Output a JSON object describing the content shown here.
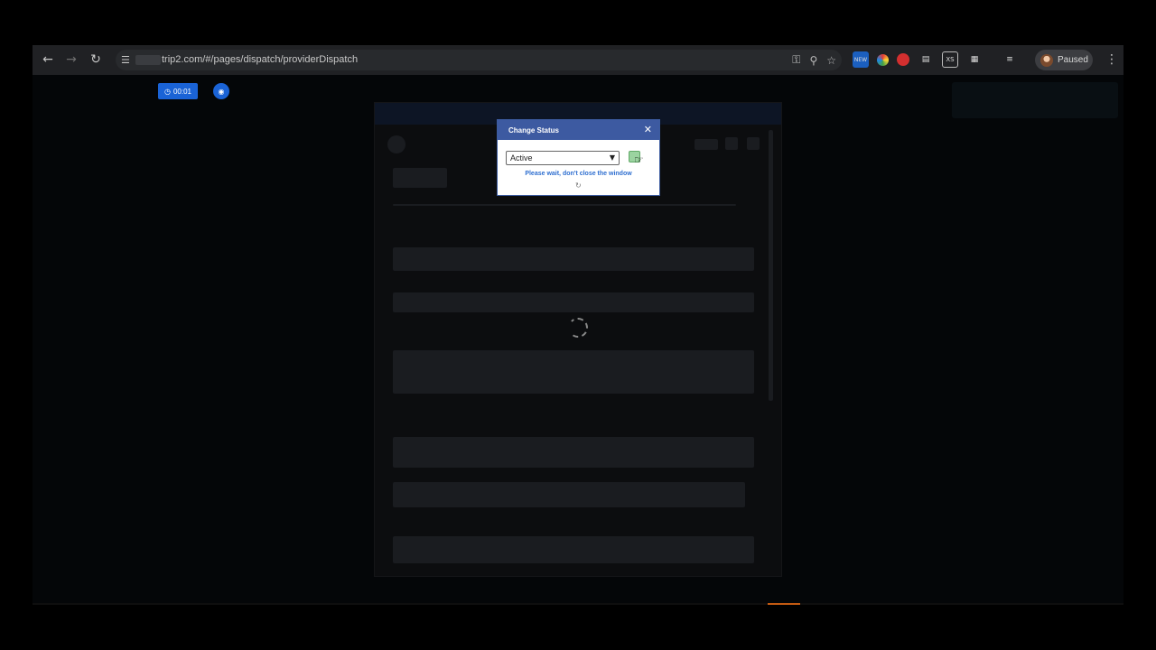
{
  "browser": {
    "url": "trip2.com/#/pages/dispatch/providerDispatch",
    "profile_label": "Paused",
    "extensions": [
      "NEW",
      "color-wheel",
      "red-shield",
      "doc",
      "XS",
      "puzzle"
    ]
  },
  "recorder": {
    "timer": "00:01"
  },
  "dialog": {
    "title": "Change Status",
    "selected_status": "Active",
    "wait_message": "Please wait, don't close the window"
  },
  "colors": {
    "dialog_header": "#3d5aa1",
    "recorder_blue": "#1a63d6",
    "wait_text": "#2f6fd0"
  }
}
